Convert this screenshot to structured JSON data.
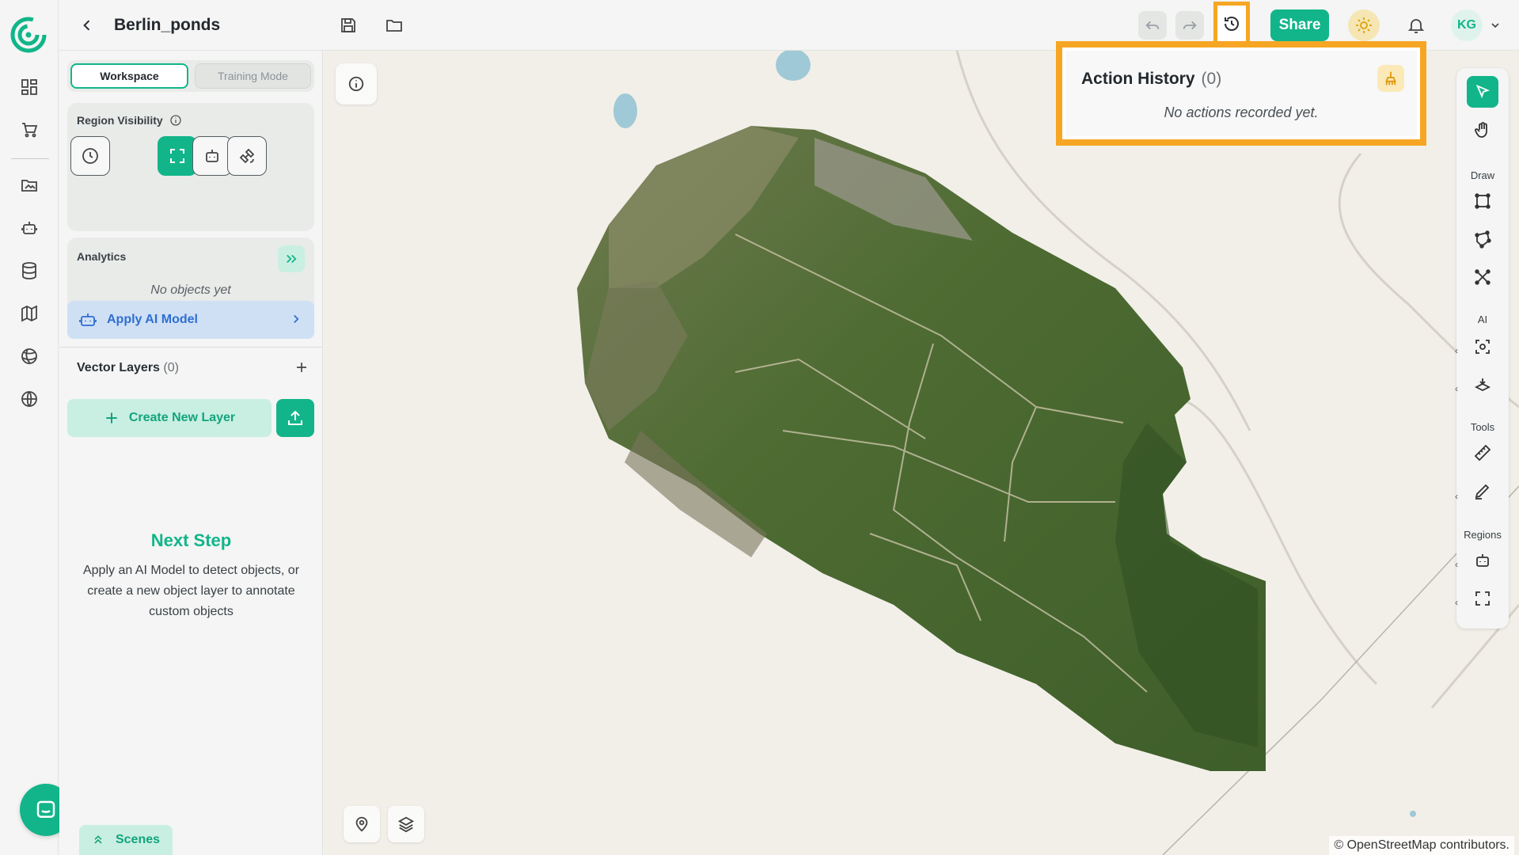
{
  "project": {
    "title": "Berlin_ponds"
  },
  "topbar": {
    "share_label": "Share",
    "user_initials": "KG"
  },
  "panel": {
    "tabs": [
      {
        "label": "Workspace",
        "active": true
      },
      {
        "label": "Training Mode",
        "active": false
      }
    ],
    "region_visibility": {
      "title": "Region Visibility"
    },
    "analytics": {
      "title": "Analytics",
      "empty": "No objects yet"
    },
    "apply_ai_label": "Apply AI Model",
    "vector_layers": {
      "title": "Vector Layers",
      "count": "(0)"
    },
    "create_layer_label": "Create New Layer",
    "next_step": {
      "title": "Next Step",
      "description": "Apply an AI Model to detect objects, or create a new object layer to annotate custom objects"
    },
    "scenes_label": "Scenes"
  },
  "action_history": {
    "title": "Action History",
    "count": "(0)",
    "empty": "No actions recorded yet."
  },
  "tools": {
    "draw_label": "Draw",
    "ai_label": "AI",
    "tools_label": "Tools",
    "regions_label": "Regions"
  },
  "map": {
    "attribution": "© OpenStreetMap contributors."
  },
  "colors": {
    "accent": "#12b58a",
    "highlight": "#f6a623",
    "ai_blue": "#2e6fd1"
  }
}
